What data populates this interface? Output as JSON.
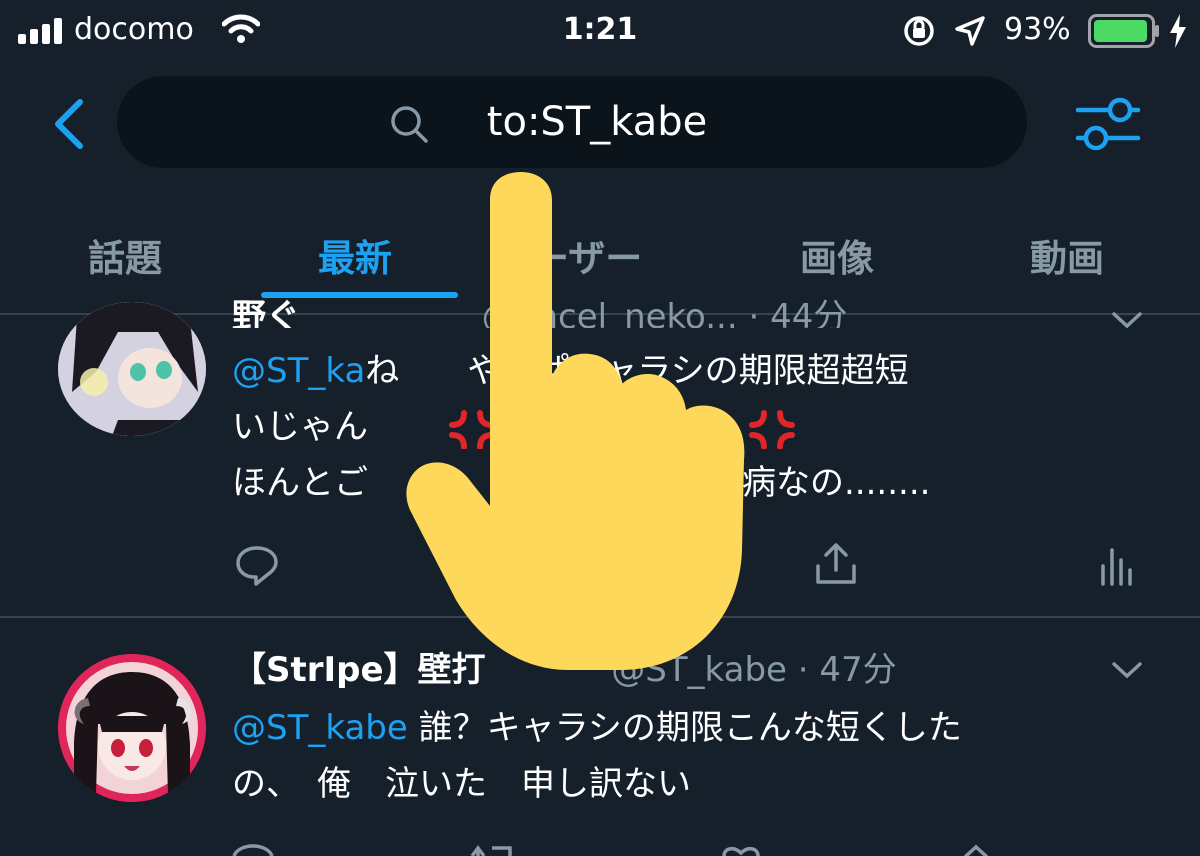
{
  "status_bar": {
    "carrier": "docomo",
    "time": "1:21",
    "battery_percent": "93%",
    "battery_level": 0.93
  },
  "header": {
    "back_icon": "chevron-left-icon",
    "search_query": "to:ST_kabe",
    "filter_icon": "sliders-icon"
  },
  "tabs": [
    {
      "label": "話題",
      "active": false
    },
    {
      "label": "最新",
      "active": true
    },
    {
      "label": "ーザー",
      "active": false
    },
    {
      "label": "画像",
      "active": false
    },
    {
      "label": "動画",
      "active": false
    }
  ],
  "tweets": [
    {
      "name": "野ぐ",
      "handle": "@ancel_neko...",
      "time": "· 44分",
      "mention": "@ST_ka",
      "line1": "ね　　やっぱキャラシの期限超超短",
      "line2": "いじゃん　　",
      "anger_count": 6,
      "line3": "ほんとご　　　　　　　　ちゃう病なの........"
    },
    {
      "name": "【StrIpe】壁打",
      "handle": "@ST_kabe",
      "time": "· 47分",
      "mention": "@ST_kabe",
      "line1": " 誰？キャラシの期限こんな短くした",
      "line2": "の、　俺　泣いた　申し訳ない"
    }
  ],
  "colors": {
    "background": "#15202b",
    "accent": "#1da1f2",
    "muted": "#8899a6",
    "overlay_hand": "#fdd85a",
    "anger": "#e0252b"
  }
}
